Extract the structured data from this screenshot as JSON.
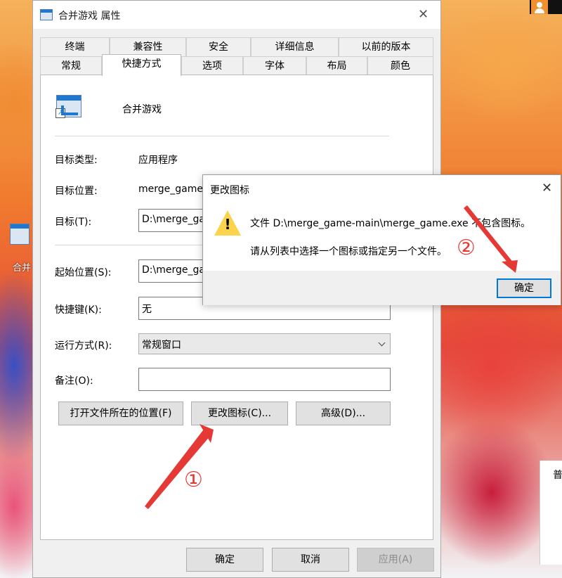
{
  "properties_window": {
    "title": "合并游戏 属性",
    "tabs_top": [
      "终端",
      "兼容性",
      "安全",
      "详细信息",
      "以前的版本"
    ],
    "tabs_bottom": [
      "常规",
      "快捷方式",
      "选项",
      "字体",
      "布局",
      "颜色"
    ],
    "active_tab": "快捷方式",
    "app_name": "合并游戏",
    "target_type_label": "目标类型:",
    "target_type_value": "应用程序",
    "target_location_label": "目标位置:",
    "target_location_value": "merge_game",
    "target_label": "目标(T):",
    "target_value": "D:\\merge_ga",
    "start_in_label": "起始位置(S):",
    "start_in_value": "D:\\merge_ga",
    "shortcut_key_label": "快捷键(K):",
    "shortcut_key_value": "无",
    "run_label": "运行方式(R):",
    "run_value": "常规窗口",
    "comment_label": "备注(O):",
    "comment_value": "",
    "buttons": {
      "open_location": "打开文件所在的位置(F)",
      "change_icon": "更改图标(C)...",
      "advanced": "高级(D)..."
    },
    "footer": {
      "ok": "确定",
      "cancel": "取消",
      "apply": "应用(A)"
    }
  },
  "change_icon_dialog": {
    "title": "更改图标",
    "message_line1": "文件 D:\\merge_game-main\\merge_game.exe 不包含图标。",
    "message_line2": "请从列表中选择一个图标或指定另一个文件。",
    "ok": "确定"
  },
  "desktop": {
    "icon_label": "合并",
    "side_window_text": "普"
  },
  "annotations": {
    "step1": "①",
    "step2": "②",
    "color": "#e53935"
  }
}
